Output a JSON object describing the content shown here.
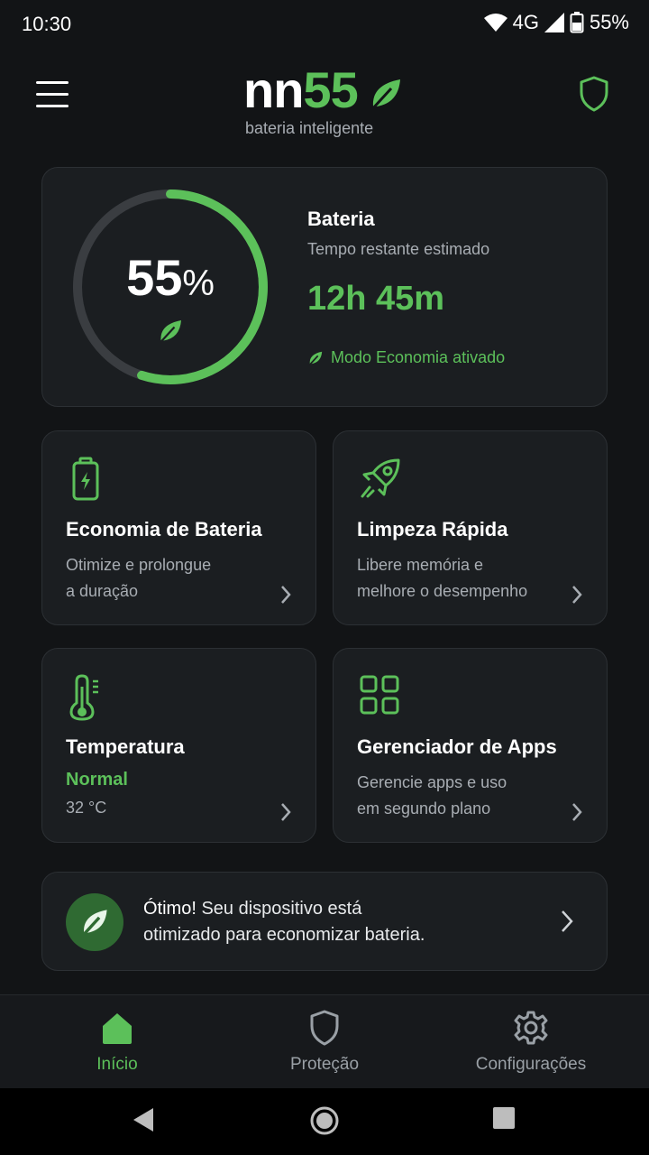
{
  "status_bar": {
    "time": "10:30",
    "network": "4G",
    "battery": "55%"
  },
  "header": {
    "logo_part1": "nn",
    "logo_part2": "55",
    "tagline": "bateria inteligente"
  },
  "battery": {
    "level_number": "55",
    "level_symbol": "%",
    "level_fraction": 0.55,
    "title": "Bateria",
    "subtitle": "Tempo restante estimado",
    "time_remaining": "12h 45m",
    "mode": "Modo Economia ativado"
  },
  "tiles": [
    {
      "title": "Economia de Bateria",
      "desc_line1": "Otimize e prolongue",
      "desc_line2": "a duração"
    },
    {
      "title": "Limpeza Rápida",
      "desc_line1": "Libere memória e",
      "desc_line2": "melhore o desempenho"
    },
    {
      "title": "Temperatura",
      "status": "Normal",
      "value": "32 °C"
    },
    {
      "title": "Gerenciador de Apps",
      "desc_line1": "Gerencie apps e uso",
      "desc_line2": "em segundo plano"
    }
  ],
  "optimization": {
    "highlight": "Ótimo!",
    "line1_rest": " Seu dispositivo está",
    "line2": "otimizado para economizar bateria."
  },
  "bottom_nav": [
    {
      "label": "Início",
      "active": true
    },
    {
      "label": "Proteção",
      "active": false
    },
    {
      "label": "Configurações",
      "active": false
    }
  ],
  "colors": {
    "accent": "#5cc05a",
    "background": "#121416",
    "card": "#1b1e21"
  }
}
